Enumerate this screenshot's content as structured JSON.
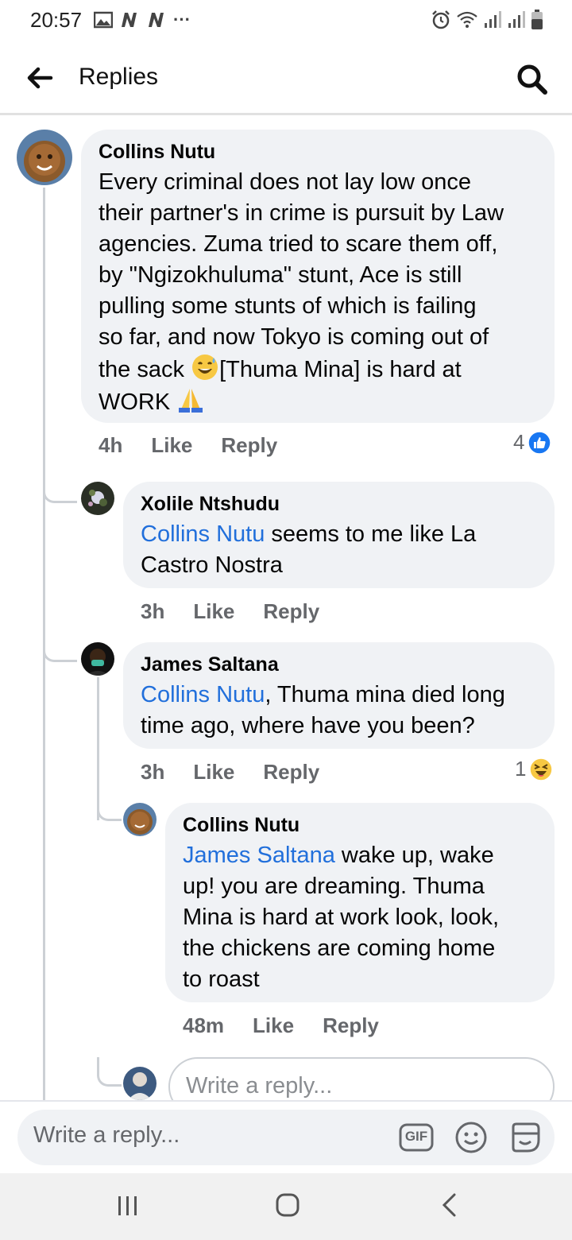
{
  "status_bar": {
    "time": "20:57",
    "more": "···"
  },
  "header": {
    "title": "Replies"
  },
  "comments": [
    {
      "author": "Collins Nutu",
      "lines": [
        "Every criminal does not lay low once",
        "their partner's in crime is pursuit by Law",
        "agencies. Zuma tried to scare them off,",
        "by \"Ngizokhuluma\" stunt, Ace is still",
        "pulling some stunts of which is failing",
        "so far,  and now Tokyo is coming out of"
      ],
      "line7_before": "the sack ",
      "line7_after": "[Thuma Mina] is hard at",
      "line8": "WORK ",
      "time": "4h",
      "like": "Like",
      "reply": "Reply",
      "reaction_count": "4"
    },
    {
      "author": "Xolile Ntshudu",
      "mention": "Collins Nutu",
      "line1_rest": " seems to me like La",
      "line2": "Castro Nostra",
      "time": "3h",
      "like": "Like",
      "reply": "Reply"
    },
    {
      "author": "James Saltana",
      "mention": "Collins Nutu",
      "line1_rest": ", Thuma mina died long",
      "line2": "time ago, where have you been?",
      "time": "3h",
      "like": "Like",
      "reply": "Reply",
      "reaction_count": "1"
    },
    {
      "author": "Collins Nutu",
      "mention": "James Saltana",
      "line1_rest": " wake up, wake",
      "lines": [
        "up! you are dreaming. Thuma",
        "Mina is hard at work look, look,",
        "the chickens are coming home",
        "to roast"
      ],
      "time": "48m",
      "like": "Like",
      "reply": "Reply"
    }
  ],
  "inline_reply": {
    "placeholder": "Write a reply..."
  },
  "composer": {
    "placeholder": "Write a reply...",
    "gif_label": "GIF"
  },
  "colors": {
    "link": "#216fdb",
    "bubble": "#f0f2f5",
    "like_blue": "#1877f2"
  }
}
